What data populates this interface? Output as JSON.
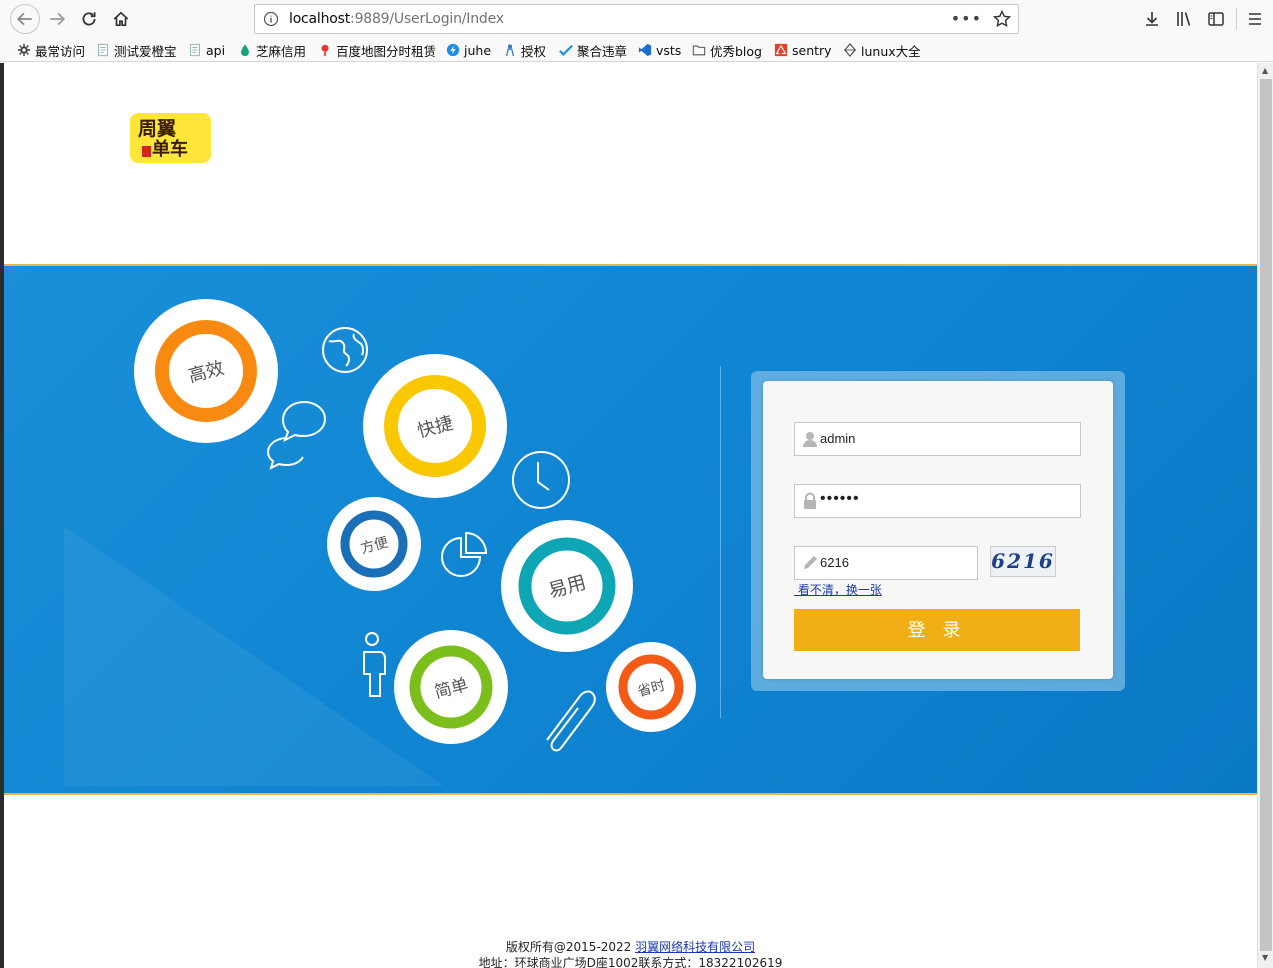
{
  "browser": {
    "url_host": "localhost",
    "url_rest": ":9889/UserLogin/Index",
    "more_label": "•••"
  },
  "bookmarks": [
    {
      "label": "最常访问",
      "icon": "gear-icon"
    },
    {
      "label": "测试爱橙宝",
      "icon": "page-icon"
    },
    {
      "label": "api",
      "icon": "page-icon"
    },
    {
      "label": "芝麻信用",
      "icon": "drop-icon"
    },
    {
      "label": "百度地图分时租赁",
      "icon": "pin-icon"
    },
    {
      "label": "juhe",
      "icon": "bolt-icon"
    },
    {
      "label": "授权",
      "icon": "person-icon"
    },
    {
      "label": "聚合违章",
      "icon": "check-icon"
    },
    {
      "label": "vsts",
      "icon": "vs-icon"
    },
    {
      "label": "优秀blog",
      "icon": "folder-icon"
    },
    {
      "label": "sentry",
      "icon": "sentry-icon"
    },
    {
      "label": "lunux大全",
      "icon": "diamond-icon"
    }
  ],
  "logo": {
    "line1": "周翼",
    "line2": "单车"
  },
  "bubbles": {
    "gaoxiao": "高效",
    "kuaijie": "快捷",
    "fangbian": "方便",
    "yiyong": "易用",
    "jiandan": "简单",
    "shengshi": "省时"
  },
  "login": {
    "username": "admin",
    "password_mask": "••••••",
    "captcha_input": "6216",
    "captcha_image_text": "6216",
    "refresh_link": " 看不清，换一张",
    "submit_label": "登 录"
  },
  "footer": {
    "copyright": "版权所有@2015-2022 ",
    "company": "羽翼网络科技有限公司",
    "line2": "地址：环球商业广场D座1002联系方式：18322102619"
  },
  "colors": {
    "banner_blue": "#1086d3",
    "login_button": "#f2ae16",
    "orange_ring": "#f88a12",
    "yellow_ring": "#f9c800",
    "blue_ring": "#1a6fb6",
    "teal_ring": "#0ea5b5",
    "green_ring": "#7cbf1c",
    "red_ring": "#f35a16"
  }
}
